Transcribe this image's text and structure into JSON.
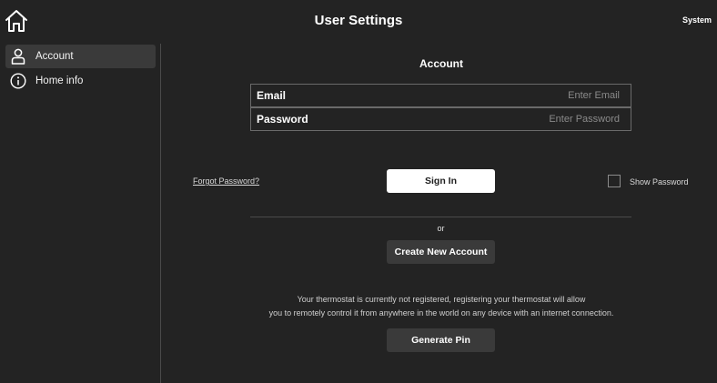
{
  "header": {
    "title": "User Settings",
    "system_label": "System",
    "home_icon": "home-icon"
  },
  "sidebar": {
    "items": [
      {
        "label": "Account",
        "icon": "user-icon",
        "active": true
      },
      {
        "label": "Home info",
        "icon": "info-icon",
        "active": false
      }
    ]
  },
  "account": {
    "title": "Account",
    "email_label": "Email",
    "email_placeholder": "Enter Email",
    "password_label": "Password",
    "password_placeholder": "Enter Password",
    "forgot_label": "Forgot Password?",
    "signin_label": "Sign In",
    "show_password_label": "Show Password",
    "or_label": "or",
    "create_label": "Create New Account",
    "info_line1": "Your thermostat is currently not registered, registering your thermostat will allow",
    "info_line2": "you to remotely control it from anywhere in  the world on any device with an internet connection.",
    "pin_label": "Generate Pin"
  },
  "colors": {
    "background": "#232323",
    "active_item": "#3a3a3a",
    "primary_button": "#ffffff",
    "secondary_button": "#3a3a3a"
  }
}
